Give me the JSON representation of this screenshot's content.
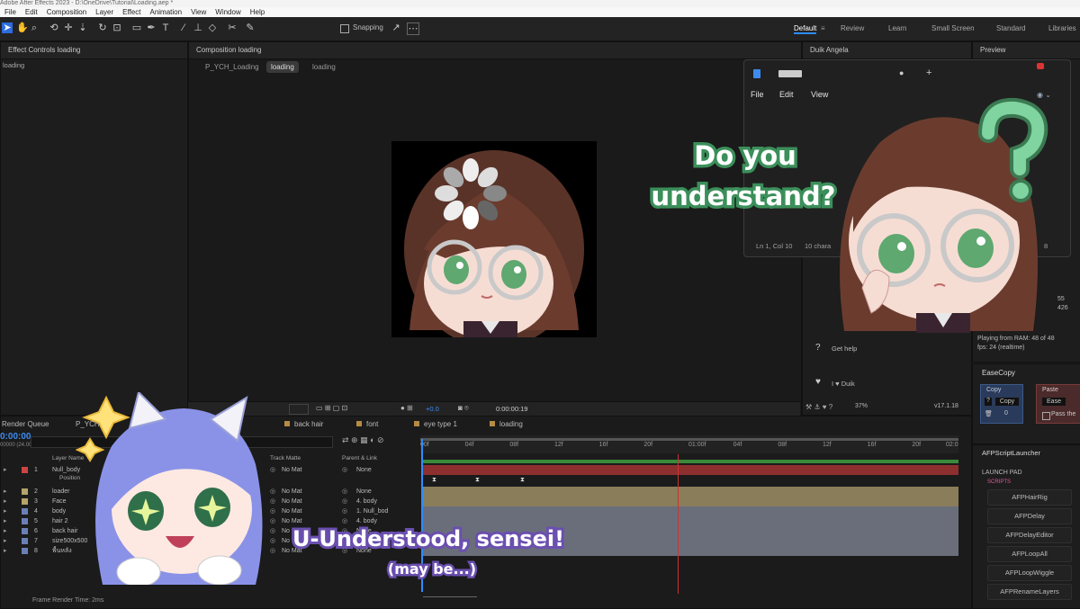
{
  "window_title": "Adobe After Effects 2023 - D:\\OneDrive\\Tutorial\\Loading.aep *",
  "menu": [
    "File",
    "Edit",
    "Composition",
    "Layer",
    "Effect",
    "Animation",
    "View",
    "Window",
    "Help"
  ],
  "toolbar": {
    "snapping_label": "Snapping"
  },
  "workspace_tabs": [
    "Default",
    "Review",
    "Learn",
    "Small Screen",
    "Standard",
    "Libraries"
  ],
  "panels": {
    "effect_controls": {
      "title": "Effect Controls loading",
      "sub": "loading"
    },
    "composition": {
      "title": "Composition loading",
      "breadcrumb": [
        "P_YCH_Loading",
        "loading",
        "loading"
      ]
    },
    "duik": {
      "title": "Duik Angela",
      "help": "Get help",
      "love": "I ♥ Duik",
      "percent": "37%",
      "version": "v17.1.18"
    },
    "preview": {
      "title": "Preview",
      "playing": "Playing from RAM: 48 of 48",
      "fps": "fps: 24 (realtime)",
      "num1": "55",
      "num2": "426"
    },
    "composition_footer": {
      "plus": "+0.0",
      "timecode": "0:00:00:19"
    }
  },
  "notepad": {
    "menu": [
      "File",
      "Edit",
      "View"
    ],
    "status_pos": "Ln 1, Col 10",
    "status_chars": "10 chara",
    "status_right": "8"
  },
  "timeline": {
    "tabs": [
      "Render Queue",
      "P_YCH",
      "back hair",
      "font",
      "eye type 1",
      "loading"
    ],
    "timecode": "0:00:00",
    "timecode_sub": "00000 (24.00 fps)",
    "ruler": [
      "00f",
      "04f",
      "08f",
      "12f",
      "16f",
      "20f",
      "01:00f",
      "04f",
      "08f",
      "12f",
      "16f",
      "20f",
      "02:0"
    ],
    "col_layer_name": "Layer Name",
    "col_track_matte": "Track Matte",
    "col_parent": "Parent & Link",
    "layers": [
      {
        "num": "1",
        "name": "Null_body",
        "matte": "No Mat",
        "parent": "None",
        "color": "#c44"
      },
      {
        "num": "2",
        "name": "loader",
        "matte": "No Mat",
        "parent": "None",
        "color": "#b5a36a"
      },
      {
        "num": "3",
        "name": "Face",
        "matte": "No Mat",
        "parent": "4. body",
        "color": "#b5a36a"
      },
      {
        "num": "4",
        "name": "body",
        "matte": "No Mat",
        "parent": "1. Null_bod",
        "color": "#6a7fb5"
      },
      {
        "num": "5",
        "name": "hair 2",
        "matte": "No Mat",
        "parent": "4. body",
        "color": "#6a7fb5"
      },
      {
        "num": "6",
        "name": "back hair",
        "matte": "No Mat",
        "parent": "None",
        "color": "#6a7fb5"
      },
      {
        "num": "7",
        "name": "size500x500",
        "matte": "No Mat",
        "parent": "None",
        "color": "#6a7fb5"
      },
      {
        "num": "8",
        "name": "พื้นหลัง",
        "matte": "No Mat",
        "parent": "None",
        "color": "#6a7fb5"
      }
    ],
    "sub_row": "Position",
    "footer": "Frame Render Time: 2ms"
  },
  "easecopy": {
    "title": "EaseCopy",
    "copy_label": "Copy",
    "paste_label": "Paste",
    "copy_btn": "Copy",
    "ease_btn": "Ease",
    "pass_label": "Pass the",
    "count": "0"
  },
  "afp": {
    "title": "AFPScriptLauncher",
    "launch_pad": "LAUNCH PAD",
    "scripts_label": "SCRIPTS",
    "scripts": [
      "AFPHairRig",
      "AFPDelay",
      "AFPDelayEditor",
      "AFPLoopAll",
      "AFPLoopWiggle",
      "AFPRenameLayers"
    ]
  },
  "captions": {
    "question": [
      "Do you",
      "understand?"
    ],
    "answer": "U-Understood, sensei!",
    "answer_sub": "(may be...)"
  },
  "colors": {
    "accent": "#2d8cff",
    "caption_fill": "#ffffff",
    "caption_outline": "#6a4fb0",
    "question_outline": "#3b8f5a",
    "question_mark": "#7fd4a0"
  }
}
